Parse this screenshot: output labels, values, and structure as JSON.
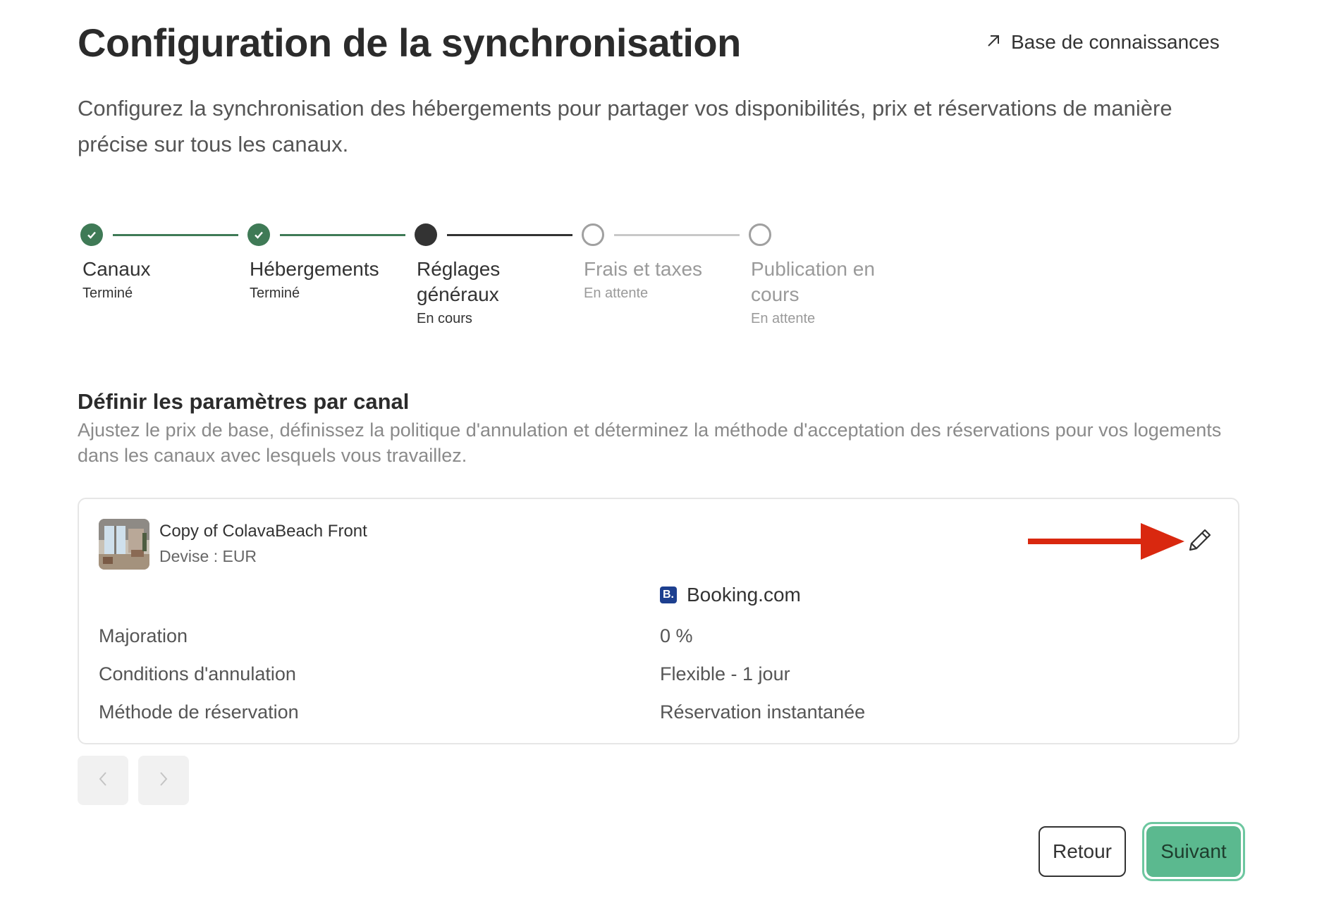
{
  "header": {
    "title": "Configuration de la synchronisation",
    "kb_link": "Base de connaissances",
    "subtitle": "Configurez la synchronisation des hébergements pour partager vos disponibilités, prix et réservations de manière précise sur tous les canaux."
  },
  "steps": [
    {
      "label": "Canaux",
      "status": "Terminé",
      "state": "done"
    },
    {
      "label": "Hébergements",
      "status": "Terminé",
      "state": "done"
    },
    {
      "label": "Réglages généraux",
      "status": "En cours",
      "state": "current"
    },
    {
      "label": "Frais et taxes",
      "status": "En attente",
      "state": "pending"
    },
    {
      "label": "Publication en cours",
      "status": "En attente",
      "state": "pending"
    }
  ],
  "section": {
    "title": "Définir les paramètres par canal",
    "description": "Ajustez le prix de base, définissez la politique d'annulation et déterminez la méthode d'acceptation des réservations pour vos logements dans les canaux avec lesquels vous travaillez."
  },
  "property": {
    "name": "Copy of ColavaBeach Front",
    "currency": "Devise : EUR"
  },
  "channel": {
    "logo_text": "B.",
    "name": "Booking.com"
  },
  "settings": [
    {
      "label": "Majoration",
      "value": "0 %"
    },
    {
      "label": "Conditions d'annulation",
      "value": "Flexible - 1 jour"
    },
    {
      "label": "Méthode de réservation",
      "value": "Réservation instantanée"
    }
  ],
  "footer": {
    "back_label": "Retour",
    "next_label": "Suivant"
  },
  "colors": {
    "done": "#3f7a56",
    "current": "#333333",
    "pending": "#a0a0a0",
    "accent": "#5bb98f",
    "annotation_arrow": "#d9280f"
  }
}
